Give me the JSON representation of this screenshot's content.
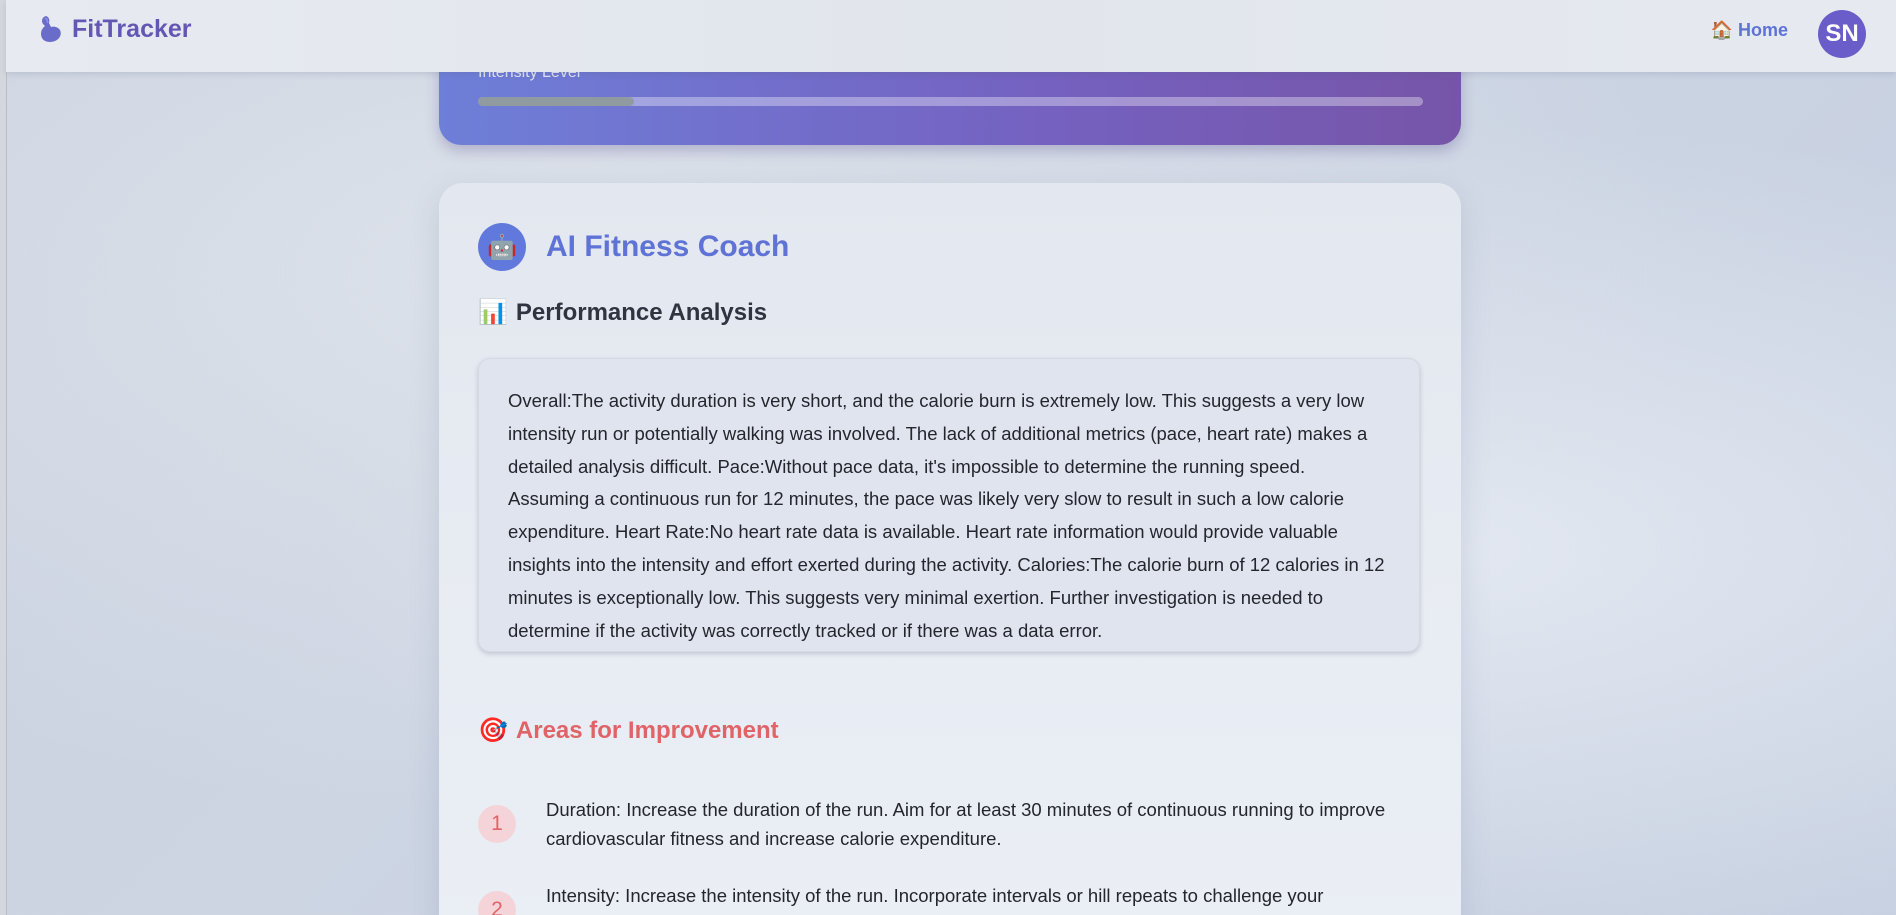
{
  "header": {
    "brand": "FitTracker",
    "brand_icon": "flexed-biceps-icon",
    "nav_home_icon": "house-icon",
    "nav_home_label": "Home",
    "avatar_initials": "SN",
    "brand_color": "#6457b3",
    "accent_color": "#5f73d6"
  },
  "intensity": {
    "label": "Intensity Level",
    "level_fraction": 0.165
  },
  "coach": {
    "icon": "robot-icon",
    "title": "AI Fitness Coach",
    "performance": {
      "icon": "bar-chart-icon",
      "heading": "Performance Analysis",
      "text": "Overall:The activity duration is very short, and the calorie burn is extremely low. This suggests a very low intensity run or potentially walking was involved. The lack of additional metrics (pace, heart rate) makes a detailed analysis difficult. Pace:Without pace data, it's impossible to determine the running speed. Assuming a continuous run for 12 minutes, the pace was likely very slow to result in such a low calorie expenditure. Heart Rate:No heart rate data is available. Heart rate information would provide valuable insights into the intensity and effort exerted during the activity. Calories:The calorie burn of 12 calories in 12 minutes is exceptionally low. This suggests very minimal exertion. Further investigation is needed to determine if the activity was correctly tracked or if there was a data error."
    },
    "improvements": {
      "icon": "target-icon",
      "heading": "Areas for Improvement",
      "heading_color": "#e06368",
      "items": [
        {
          "number": "1",
          "text": "Duration: Increase the duration of the run. Aim for at least 30 minutes of continuous running to improve cardiovascular fitness and increase calorie expenditure."
        },
        {
          "number": "2",
          "text": "Intensity: Increase the intensity of the run. Incorporate intervals or hill repeats to challenge your"
        }
      ]
    }
  }
}
